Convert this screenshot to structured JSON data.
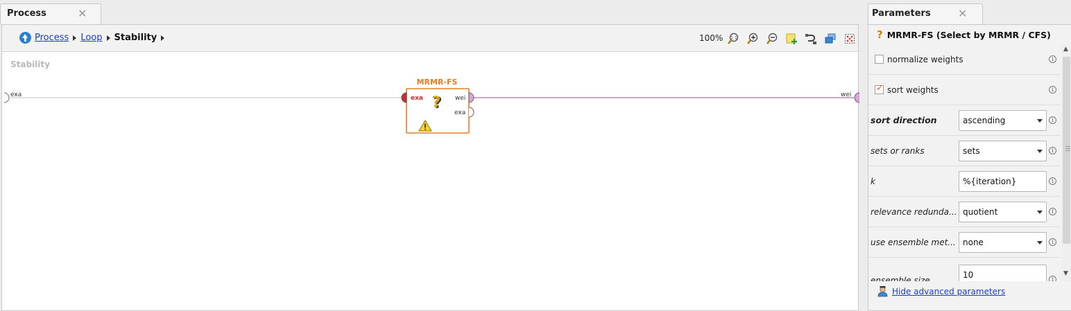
{
  "process_tab": {
    "title": "Process",
    "close": "✕"
  },
  "breadcrumb": {
    "items": [
      "Process",
      "Loop"
    ],
    "current": "Stability"
  },
  "toolbar": {
    "zoom": "100%"
  },
  "canvas": {
    "label": "Stability",
    "left_port": "exa",
    "right_port": "wei",
    "operator": {
      "name": "MRMR-FS",
      "in_port": "exa",
      "out_port_1": "wei",
      "out_port_2": "exa",
      "status": "warning"
    }
  },
  "parameters_tab": {
    "title": "Parameters",
    "close": "✕"
  },
  "parameters": {
    "operator_title": "MRMR-FS (Select by MRMR / CFS)",
    "normalize_weights": {
      "label": "normalize weights",
      "checked": false
    },
    "sort_weights": {
      "label": "sort weights",
      "checked": true
    },
    "sort_direction": {
      "label": "sort direction",
      "value": "ascending"
    },
    "sets_or_ranks": {
      "label": "sets or ranks",
      "value": "sets"
    },
    "k": {
      "label": "k",
      "value": "%{iteration}"
    },
    "relevance_redundancy": {
      "label": "relevance redunda...",
      "value": "quotient"
    },
    "use_ensemble": {
      "label": "use ensemble met...",
      "value": "none"
    },
    "ensemble_size": {
      "label": "ensemble size",
      "value": "10"
    },
    "advanced_link": "Hide advanced parameters",
    "info_glyph": "i",
    "check_glyph": "✓"
  },
  "colors": {
    "operator_border": "#e67e22",
    "port_red": "#d12a2a",
    "connection": "#b78bb5",
    "link": "#1a3fbf"
  }
}
